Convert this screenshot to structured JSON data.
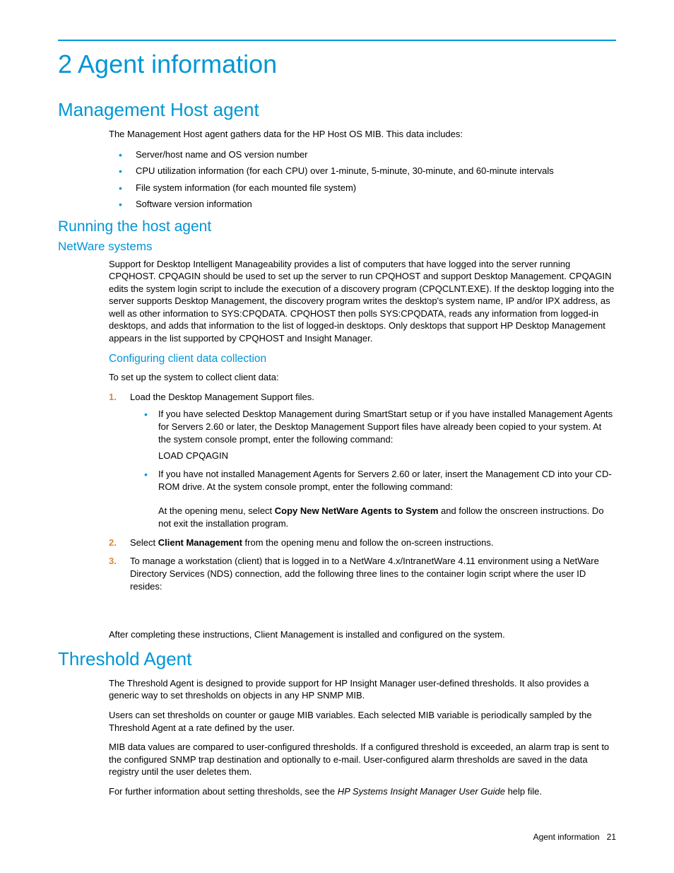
{
  "chapter_title": "2 Agent information",
  "section1": {
    "title": "Management Host agent",
    "intro": "The Management Host agent gathers data for the HP Host OS MIB. This data includes:",
    "bullets": [
      "Server/host name and OS version number",
      "CPU utilization information (for each CPU) over 1-minute, 5-minute, 30-minute, and 60-minute intervals",
      "File system information (for each mounted file system)",
      "Software version information"
    ],
    "sub1": {
      "title": "Running the host agent",
      "netware": {
        "title": "NetWare systems",
        "para": "Support for Desktop Intelligent Manageability provides a list of computers that have logged into the server running CPQHOST. CPQAGIN should be used to set up the server to run CPQHOST and support Desktop Management. CPQAGIN edits the system login script to include the execution of a discovery program (CPQCLNT.EXE). If the desktop logging into the server supports Desktop Management, the discovery program writes the desktop's system name, IP and/or IPX address, as well as other information to SYS:CPQDATA. CPQHOST then polls SYS:CPQDATA, reads any information from logged-in desktops, and adds that information to the list of logged-in desktops. Only desktops that support HP Desktop Management appears in the list supported by CPQHOST and Insight Manager.",
        "config": {
          "title": "Configuring client data collection",
          "intro": "To set up the system to collect client data:",
          "step1": "Load the Desktop Management Support files.",
          "step1_b1a": "If you have selected Desktop Management during SmartStart setup or if you have installed Management Agents for Servers 2.60 or later, the Desktop Management Support files have already been copied to your system. At the system console prompt, enter the following command:",
          "step1_b1_cmd": "LOAD CPQAGIN",
          "step1_b2a": "If you have not installed Management Agents for Servers 2.60 or later, insert the Management CD into your CD-ROM drive. At the system console prompt, enter the following command:",
          "step1_b2_note_a": "At the opening menu, select ",
          "step1_b2_note_bold": "Copy New NetWare Agents to System",
          "step1_b2_note_b": " and follow the onscreen instructions. Do not exit the installation program.",
          "step2_a": "Select ",
          "step2_bold": "Client Management",
          "step2_b": " from the opening menu and follow the on-screen instructions.",
          "step3": "To manage a workstation (client) that is logged in to a NetWare 4.x/IntranetWare 4.11 environment using a NetWare Directory Services (NDS) connection, add the following three lines to the container login script where the user ID resides:",
          "closing": "After completing these instructions, Client Management is installed and configured on the system."
        }
      }
    }
  },
  "section2": {
    "title": "Threshold Agent",
    "p1": "The Threshold Agent is designed to provide support for HP Insight Manager user-defined thresholds. It also provides a generic way to set thresholds on objects in any HP SNMP MIB.",
    "p2": "Users can set thresholds on counter or gauge MIB variables. Each selected MIB variable is periodically sampled by the Threshold Agent at a rate defined by the user.",
    "p3": "MIB data values are compared to user-configured thresholds. If a configured threshold is exceeded, an alarm trap is sent to the configured SNMP trap destination and optionally to e-mail. User-configured alarm thresholds are saved in the data registry until the user deletes them.",
    "p4_a": "For further information about setting thresholds, see the ",
    "p4_italic": "HP Systems Insight Manager User Guide",
    "p4_b": " help file."
  },
  "footer": {
    "label": "Agent information",
    "page": "21"
  }
}
